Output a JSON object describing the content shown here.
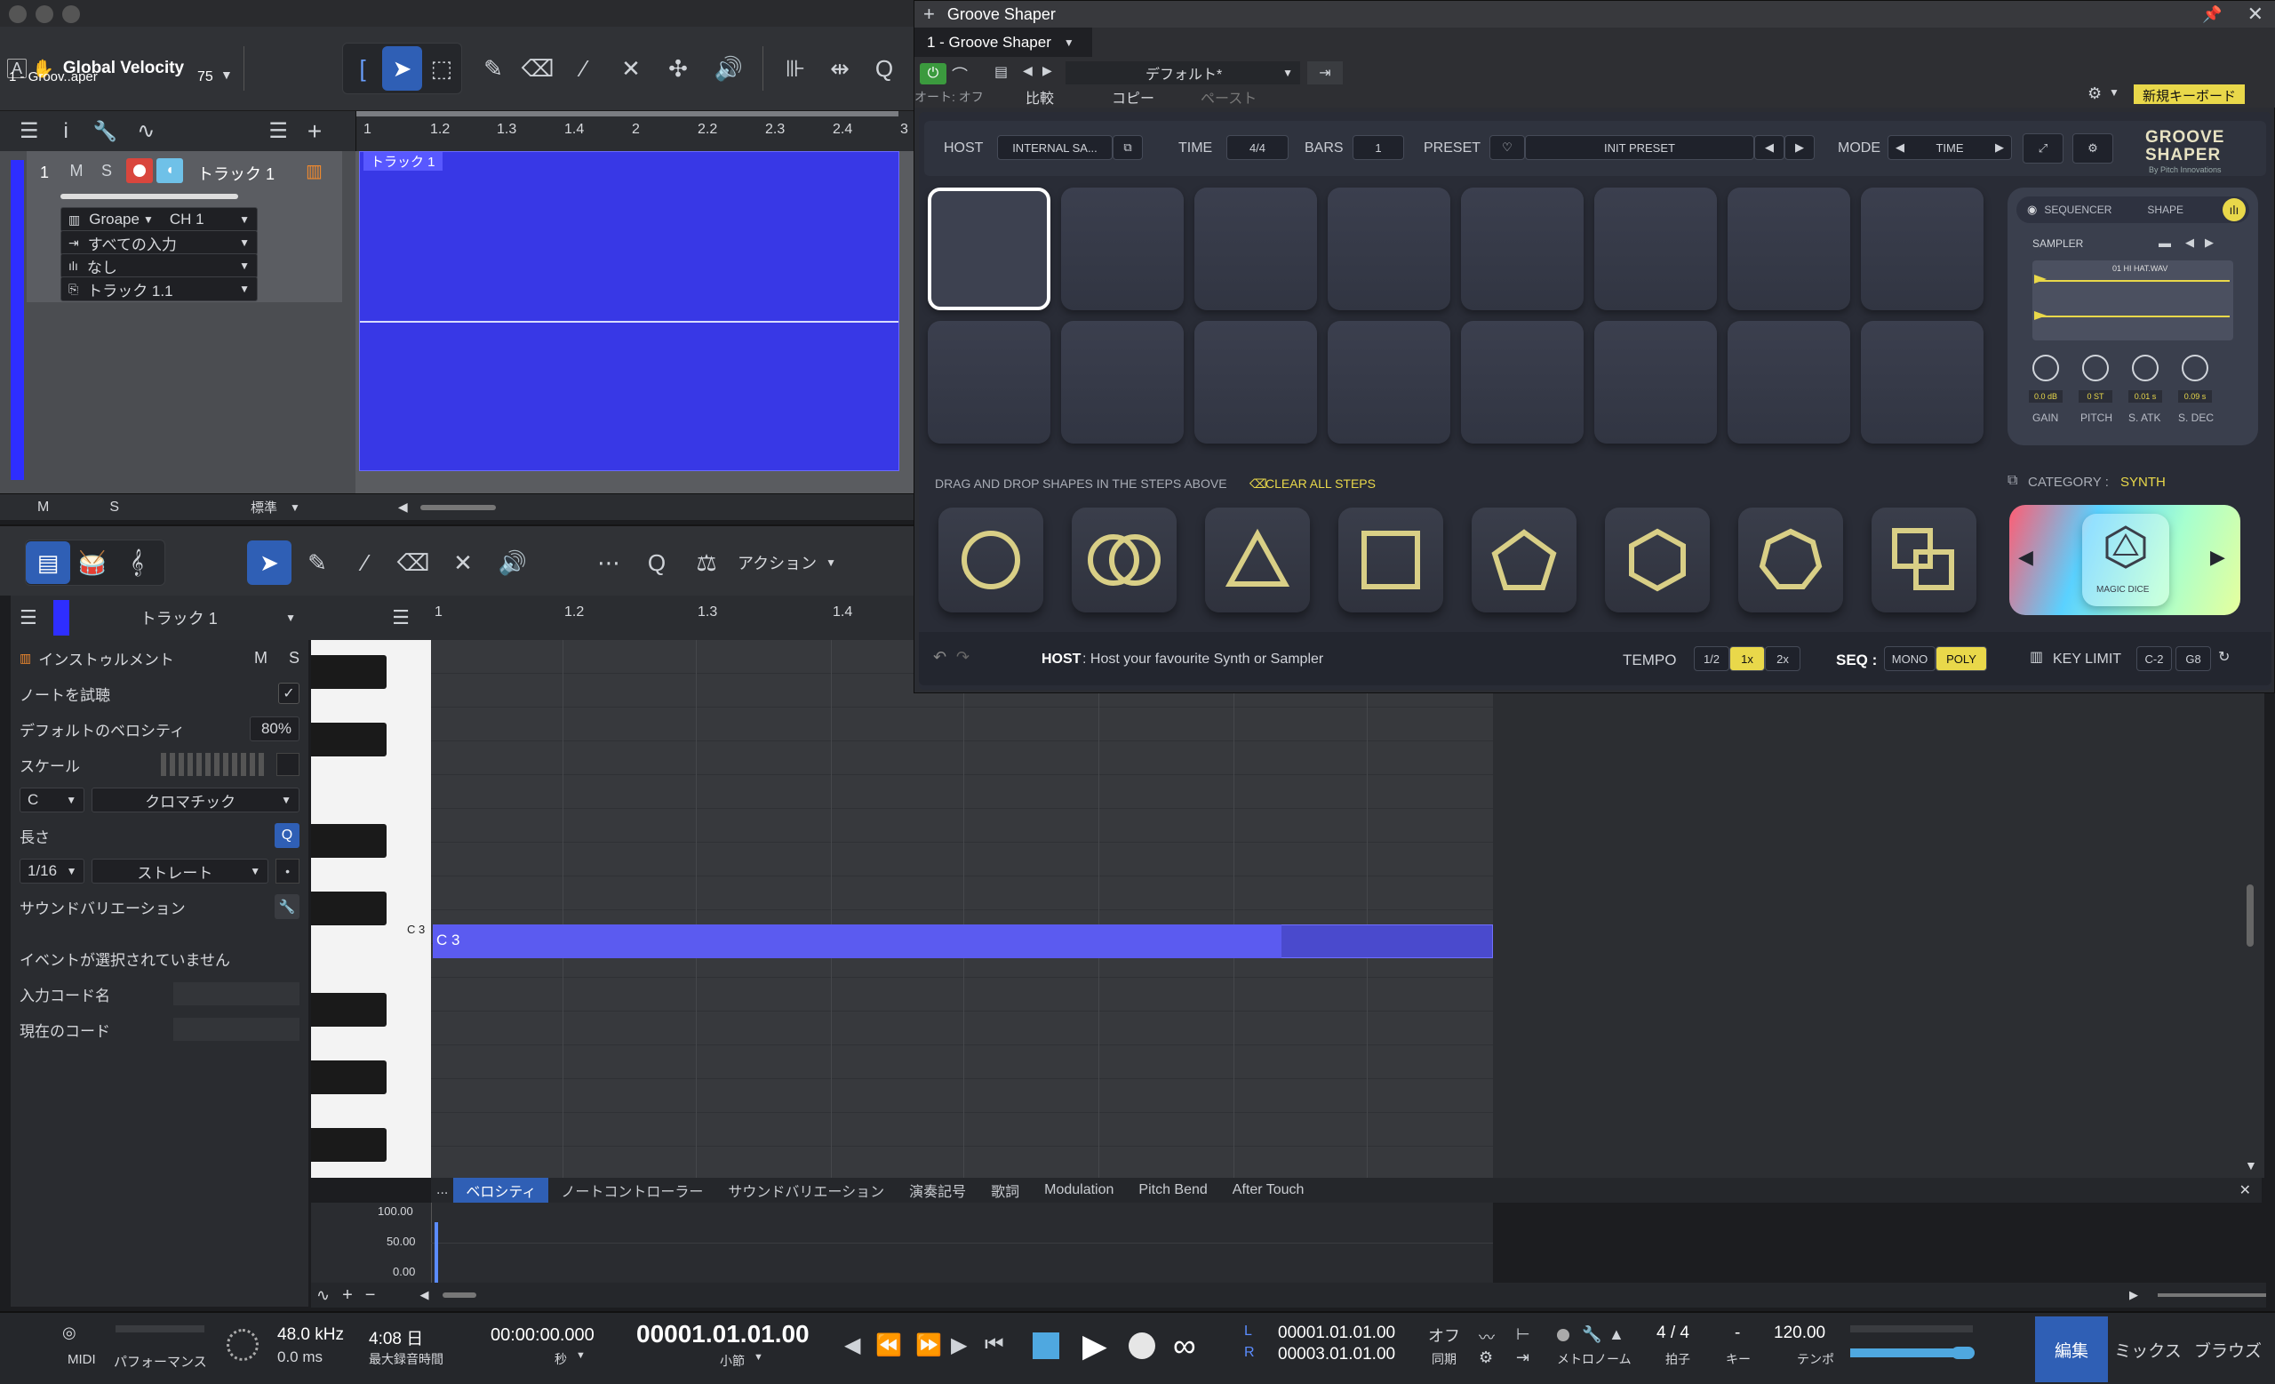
{
  "daw": {
    "window_title_track": "Global Velocity",
    "window_sub": "1 - Groov..aper",
    "velocity_value": "75",
    "track": {
      "number": "1",
      "m": "M",
      "s": "S",
      "name": "トラック 1",
      "instrument": "Groape",
      "channel": "CH 1",
      "input": "すべての入力",
      "none": "なし",
      "output": "トラック 1.1",
      "clip_label": "トラック 1"
    },
    "ruler_marks": [
      "1",
      "1.2",
      "1.3",
      "1.4",
      "2",
      "2.2",
      "2.3",
      "2.4",
      "3"
    ],
    "footer": {
      "m": "M",
      "s": "S",
      "mode": "標準"
    },
    "editor": {
      "action_label": "アクション",
      "track_name": "トラック 1",
      "ruler_marks": [
        "1",
        "1.2",
        "1.3",
        "1.4"
      ],
      "inspector": {
        "instrument": "インストゥルメント",
        "m": "M",
        "s": "S",
        "audition": "ノートを試聴",
        "default_velocity_label": "デフォルトのベロシティ",
        "default_velocity_value": "80%",
        "scale_label": "スケール",
        "root": "C",
        "scale_type": "クロマチック",
        "length_label": "長さ",
        "length_value": "1/16",
        "length_type": "ストレート",
        "sound_variation": "サウンドバリエーション",
        "no_event": "イベントが選択されていません",
        "chord_input": "入力コード名",
        "current_chord": "現在のコード"
      },
      "key_label": "C 3",
      "note_label": "C 3",
      "controller_tabs": [
        "...",
        "ベロシティ",
        "ノートコントローラー",
        "サウンドバリエーション",
        "演奏記号",
        "歌詞",
        "Modulation",
        "Pitch Bend",
        "After Touch"
      ],
      "lane_values": [
        "100.00",
        "50.00",
        "0.00"
      ]
    },
    "transport": {
      "midi": "MIDI",
      "performance": "パフォーマンス",
      "sample_rate": "48.0 kHz",
      "latency": "0.0 ms",
      "rec_time": "4:08 日",
      "rec_time_label": "最大録音時間",
      "time_sec": "00:00:00.000",
      "time_sec_label": "秒",
      "bars": "00001.01.01.00",
      "bars_label": "小節",
      "loop_l": "00001.01.01.00",
      "loop_r": "00003.01.01.00",
      "l": "L",
      "r": "R",
      "sync_val": "オフ",
      "sync_label": "同期",
      "metronome": "メトロノーム",
      "signature": "4 / 4",
      "signature_label": "拍子",
      "key_val": "-",
      "key_label": "キー",
      "tempo": "120.00",
      "tempo_label": "テンポ",
      "tabs": [
        "編集",
        "ミックス",
        "ブラウズ"
      ]
    }
  },
  "plugin": {
    "title": "Groove Shaper",
    "instance": "1 - Groove Shaper",
    "preset_default": "デフォルト*",
    "auto_off": "オート: オフ",
    "compare": "比較",
    "copy": "コピー",
    "paste": "ペースト",
    "new_keyboard": "新規キーボード",
    "top": {
      "host_label": "HOST",
      "host_value": "INTERNAL SA...",
      "time_label": "TIME",
      "time_value": "4/4",
      "bars_label": "BARS",
      "bars_value": "1",
      "preset_label": "PRESET",
      "preset_value": "INIT PRESET",
      "mode_label": "MODE",
      "mode_value": "TIME",
      "logo_line1": "GROOVE",
      "logo_line2": "SHAPER",
      "logo_sub": "By Pitch Innovations"
    },
    "right": {
      "seq": "SEQUENCER",
      "shape": "SHAPE",
      "sampler": "SAMPLER",
      "sample_name": "01 HI HAT.WAV",
      "knobs": [
        {
          "value": "0.0 dB",
          "label": "GAIN"
        },
        {
          "value": "0 ST",
          "label": "PITCH"
        },
        {
          "value": "0.01 s",
          "label": "S. ATK"
        },
        {
          "value": "0.09 s",
          "label": "S. DEC"
        }
      ]
    },
    "drag_hint": "DRAG AND DROP SHAPES IN THE STEPS ABOVE",
    "clear_all": "CLEAR ALL STEPS",
    "category_label": "CATEGORY :",
    "category_value": "SYNTH",
    "magic_dice": "MAGIC DICE",
    "bottom": {
      "host_bold": "HOST",
      "host_desc": ": Host your favourite Synth or Sampler",
      "tempo_label": "TEMPO",
      "tempo_opts": [
        "1/2",
        "1x",
        "2x"
      ],
      "seq_label": "SEQ :",
      "seq_opts": [
        "MONO",
        "POLY"
      ],
      "key_limit": "KEY LIMIT",
      "key_lo": "C-2",
      "key_hi": "G8"
    }
  },
  "colors": {
    "accent_yellow": "#e9d84a",
    "track_blue": "#3838e6",
    "shape_gold": "#d9cf86"
  }
}
